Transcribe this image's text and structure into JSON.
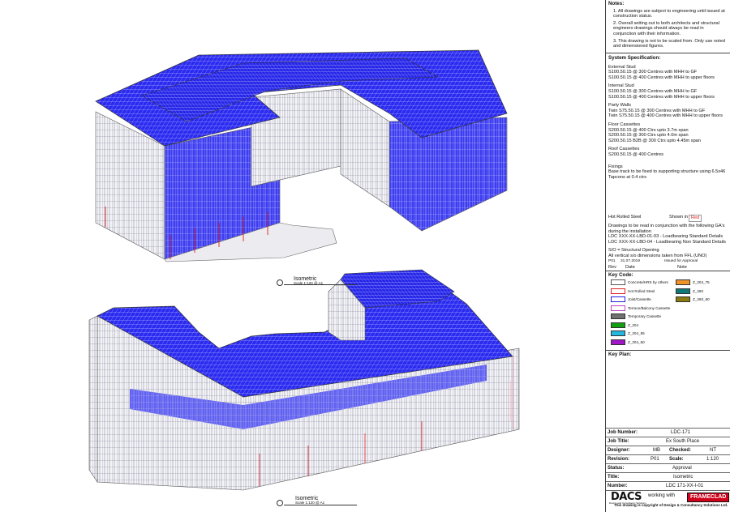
{
  "notes": {
    "title": "Notes:",
    "items": [
      "1. All drawings are subject to engineering until issued at construction status.",
      "2. Overall setting out to both architects and structural engineers drawings should always be read in conjunction with their information.",
      "3. This drawing is not to be scaled from. Only use noted and dimensioned figures."
    ]
  },
  "spec": {
    "title": "System Specification:",
    "groups": [
      {
        "name": "External Stud",
        "lines": [
          "S100.50.15 @ 300 Centres with MHH to GF",
          "S100.50.15 @ 400 Centres with MHH to upper floors"
        ]
      },
      {
        "name": "Internal Stud",
        "lines": [
          "S100.50.15 @ 300 Centres with MHH to GF",
          "S100.50.15 @ 400 Centres with MHH to upper floors"
        ]
      },
      {
        "name": "Party Walls",
        "lines": [
          "Twin S75.50.15 @ 300 Centres with MHH to GF",
          "Twin S75.50.15 @ 400 Centres with MHH to upper floors"
        ]
      },
      {
        "name": "Floor Cassettes",
        "lines": [
          "S200.50.15 @ 400 Ctrs upto 3.7m span",
          "S200.50.15 @ 300 Ctrs upto 4.0m span",
          "S200.50.15 B2B @ 300 Ctrs upto 4.45m span"
        ]
      },
      {
        "name": "Roof Cassettes",
        "lines": [
          "S200.50.15 @ 400 Centres"
        ]
      },
      {
        "name": "Fixings",
        "lines": [
          "Base track to be fixed to supporting structure using 6.5x46 Tapcons at 0.4 ctrs"
        ]
      }
    ]
  },
  "hot_rolled": {
    "label": "Hot Rolled Steel",
    "shown_in": "Shown in",
    "color_word": "Red"
  },
  "conjunction": {
    "lines": [
      "Drawings to be read in conjunction with the following GA's during the installation",
      "LDC XXX-XX-LBD-01-03 - Loadbearing Standard Details",
      "LDC XXX-XX-LBD-04 - Loadbearing Non Standard Details",
      "S/O = Structural Opening",
      "All vertical s/o dimensions taken from FFL (UNO)"
    ]
  },
  "revisions": {
    "entry": {
      "rev": "P01",
      "date": "31.07.2019",
      "note": "Issued for Approval"
    },
    "headers": {
      "rev": "Rev",
      "date": "Date",
      "note": "Note"
    }
  },
  "key": {
    "title": "Key Code:",
    "items": [
      {
        "label": "Concrete/HRS by others",
        "color": "#ffffff",
        "border": "#555555"
      },
      {
        "label": "Hot Rolled Steel",
        "color": "#ffffff",
        "border": "#e02020"
      },
      {
        "label": "Joist/Cassette",
        "color": "#ffffff",
        "border": "#2020e0"
      },
      {
        "label": "Terrace/Balcony Cassette",
        "color": "#ffffff",
        "border": "#c040c0"
      },
      {
        "label": "Temporary Cassette",
        "color": "#707070",
        "border": "#333333"
      },
      {
        "label": "Z_204",
        "color": "#12a012",
        "border": "#333333"
      },
      {
        "label": "Z_204_55",
        "color": "#22b8e0",
        "border": "#333333"
      },
      {
        "label": "Z_204_60",
        "color": "#a016c8",
        "border": "#333333"
      },
      {
        "label": "Z_204_75",
        "color": "#f0922a",
        "border": "#333333"
      },
      {
        "label": "Z_260",
        "color": "#107878",
        "border": "#333333"
      },
      {
        "label": "Z_260_60",
        "color": "#8a7a10",
        "border": "#333333"
      }
    ]
  },
  "key_plan": {
    "title": "Key Plan:"
  },
  "title_block": {
    "job_number_label": "Job Number:",
    "job_number": "LDC-171",
    "job_title_label": "Job Title:",
    "job_title": "Ex South Place",
    "designer_label": "Designer:",
    "designer": "MB",
    "checked_label": "Checked:",
    "checked": "NT",
    "revision_label": "Revision:",
    "revision": "P01",
    "scale_label": "Scale:",
    "scale": "1:120",
    "status_label": "Status:",
    "status": "Approval",
    "title_label": "Title:",
    "title": "Isometric",
    "number_label": "Number:",
    "number": "LDC 171-XX-I-01",
    "logo_left": "DACS",
    "logo_left_sub": "Design and Consultancy Solutions",
    "working_with": "working with",
    "logo_right": "FRAMECLAD",
    "copyright": "This drawing is copyright of Design & Consultancy Solutions Ltd."
  },
  "captions": [
    {
      "title": "Isometric",
      "scale": "Scale 1:120 @ A1"
    },
    {
      "title": "Isometric",
      "scale": "Scale 1:120 @ A1"
    }
  ],
  "colors": {
    "frame_blue": "#1e1ee8",
    "frame_grey": "#8a8a9a",
    "hot_rolled": "#e02020",
    "pink": "#e890a8"
  }
}
